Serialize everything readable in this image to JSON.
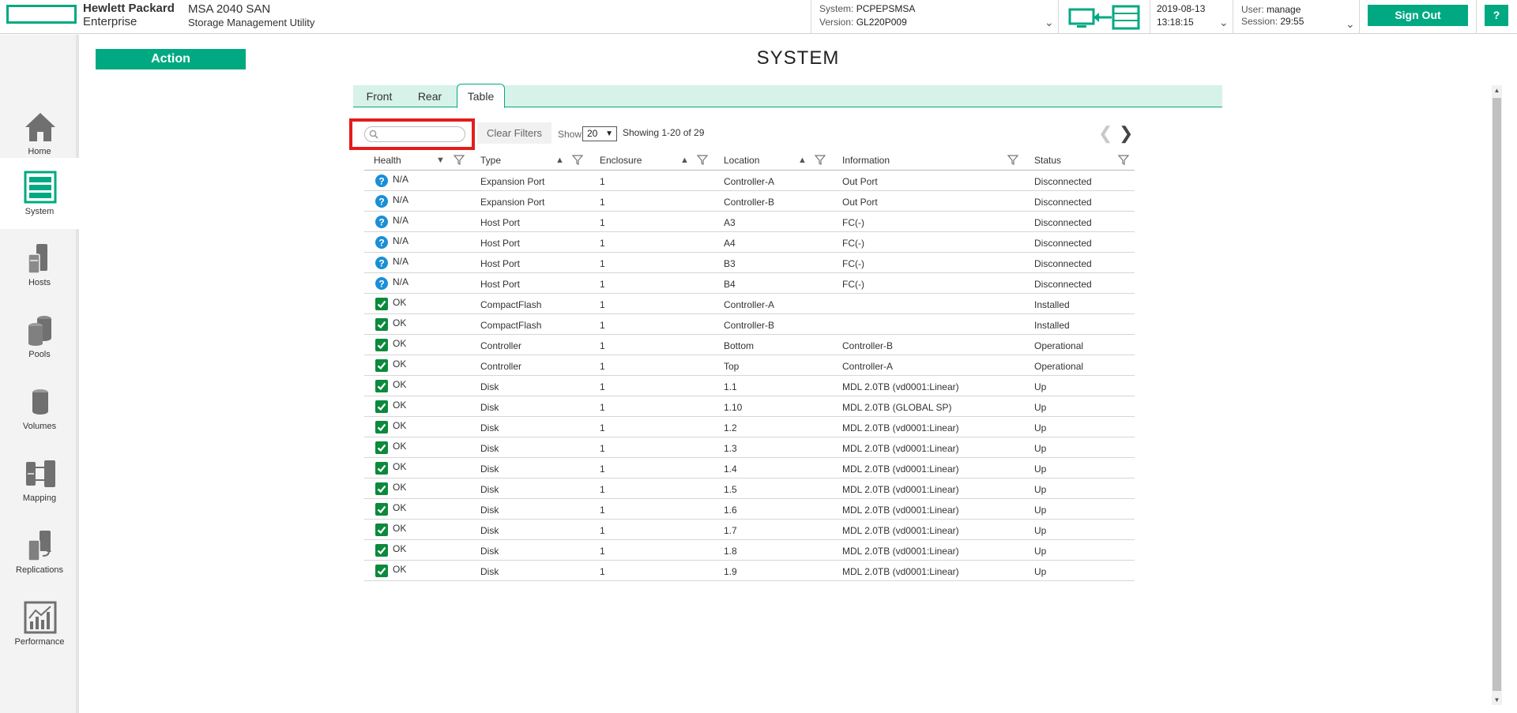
{
  "header": {
    "logo_line1": "Hewlett Packard",
    "logo_line2": "Enterprise",
    "product_name": "MSA 2040 SAN",
    "product_sub": "Storage Management Utility",
    "system_label": "System:",
    "system_value": "PCPEPSMSA",
    "version_label": "Version:",
    "version_value": "GL220P009",
    "date": "2019-08-13",
    "time": "13:18:15",
    "user_label": "User:",
    "user_value": "manage",
    "session_label": "Session:",
    "session_value": "29:55",
    "sign_out": "Sign Out",
    "help": "?"
  },
  "sidebar": {
    "items": [
      {
        "label": "Home",
        "icon": "home-icon"
      },
      {
        "label": "System",
        "icon": "system-icon",
        "active": true
      },
      {
        "label": "Hosts",
        "icon": "hosts-icon"
      },
      {
        "label": "Pools",
        "icon": "pools-icon"
      },
      {
        "label": "Volumes",
        "icon": "volumes-icon"
      },
      {
        "label": "Mapping",
        "icon": "mapping-icon"
      },
      {
        "label": "Replications",
        "icon": "replications-icon"
      },
      {
        "label": "Performance",
        "icon": "performance-icon"
      }
    ]
  },
  "main": {
    "action_label": "Action",
    "title": "SYSTEM",
    "tabs": [
      {
        "label": "Front"
      },
      {
        "label": "Rear"
      },
      {
        "label": "Table",
        "active": true
      }
    ],
    "toolbar": {
      "search_placeholder": "",
      "clear_filters": "Clear Filters",
      "show_label": "Show",
      "show_value": "20",
      "showing_text": "Showing 1-20 of 29"
    },
    "columns": [
      "Health",
      "Type",
      "Enclosure",
      "Location",
      "Information",
      "Status"
    ],
    "rows": [
      {
        "health": "N/A",
        "state": "unknown",
        "type": "Expansion Port",
        "enclosure": "1",
        "location": "Controller-A",
        "information": "Out Port",
        "status": "Disconnected"
      },
      {
        "health": "N/A",
        "state": "unknown",
        "type": "Expansion Port",
        "enclosure": "1",
        "location": "Controller-B",
        "information": "Out Port",
        "status": "Disconnected"
      },
      {
        "health": "N/A",
        "state": "unknown",
        "type": "Host Port",
        "enclosure": "1",
        "location": "A3",
        "information": "FC(-)",
        "status": "Disconnected"
      },
      {
        "health": "N/A",
        "state": "unknown",
        "type": "Host Port",
        "enclosure": "1",
        "location": "A4",
        "information": "FC(-)",
        "status": "Disconnected"
      },
      {
        "health": "N/A",
        "state": "unknown",
        "type": "Host Port",
        "enclosure": "1",
        "location": "B3",
        "information": "FC(-)",
        "status": "Disconnected"
      },
      {
        "health": "N/A",
        "state": "unknown",
        "type": "Host Port",
        "enclosure": "1",
        "location": "B4",
        "information": "FC(-)",
        "status": "Disconnected"
      },
      {
        "health": "OK",
        "state": "ok",
        "type": "CompactFlash",
        "enclosure": "1",
        "location": "Controller-A",
        "information": "",
        "status": "Installed"
      },
      {
        "health": "OK",
        "state": "ok",
        "type": "CompactFlash",
        "enclosure": "1",
        "location": "Controller-B",
        "information": "",
        "status": "Installed"
      },
      {
        "health": "OK",
        "state": "ok",
        "type": "Controller",
        "enclosure": "1",
        "location": "Bottom",
        "information": "Controller-B",
        "status": "Operational"
      },
      {
        "health": "OK",
        "state": "ok",
        "type": "Controller",
        "enclosure": "1",
        "location": "Top",
        "information": "Controller-A",
        "status": "Operational"
      },
      {
        "health": "OK",
        "state": "ok",
        "type": "Disk",
        "enclosure": "1",
        "location": "1.1",
        "information": "MDL 2.0TB (vd0001:Linear)",
        "status": "Up"
      },
      {
        "health": "OK",
        "state": "ok",
        "type": "Disk",
        "enclosure": "1",
        "location": "1.10",
        "information": "MDL 2.0TB (GLOBAL SP)",
        "status": "Up"
      },
      {
        "health": "OK",
        "state": "ok",
        "type": "Disk",
        "enclosure": "1",
        "location": "1.2",
        "information": "MDL 2.0TB (vd0001:Linear)",
        "status": "Up"
      },
      {
        "health": "OK",
        "state": "ok",
        "type": "Disk",
        "enclosure": "1",
        "location": "1.3",
        "information": "MDL 2.0TB (vd0001:Linear)",
        "status": "Up"
      },
      {
        "health": "OK",
        "state": "ok",
        "type": "Disk",
        "enclosure": "1",
        "location": "1.4",
        "information": "MDL 2.0TB (vd0001:Linear)",
        "status": "Up"
      },
      {
        "health": "OK",
        "state": "ok",
        "type": "Disk",
        "enclosure": "1",
        "location": "1.5",
        "information": "MDL 2.0TB (vd0001:Linear)",
        "status": "Up"
      },
      {
        "health": "OK",
        "state": "ok",
        "type": "Disk",
        "enclosure": "1",
        "location": "1.6",
        "information": "MDL 2.0TB (vd0001:Linear)",
        "status": "Up"
      },
      {
        "health": "OK",
        "state": "ok",
        "type": "Disk",
        "enclosure": "1",
        "location": "1.7",
        "information": "MDL 2.0TB (vd0001:Linear)",
        "status": "Up"
      },
      {
        "health": "OK",
        "state": "ok",
        "type": "Disk",
        "enclosure": "1",
        "location": "1.8",
        "information": "MDL 2.0TB (vd0001:Linear)",
        "status": "Up"
      },
      {
        "health": "OK",
        "state": "ok",
        "type": "Disk",
        "enclosure": "1",
        "location": "1.9",
        "information": "MDL 2.0TB (vd0001:Linear)",
        "status": "Up"
      }
    ]
  },
  "colors": {
    "accent": "#01a982",
    "tab_bar": "#d7f2e9",
    "highlight": "#e41c1c",
    "unknown": "#1a8fd6",
    "ok": "#0b8a3c"
  }
}
